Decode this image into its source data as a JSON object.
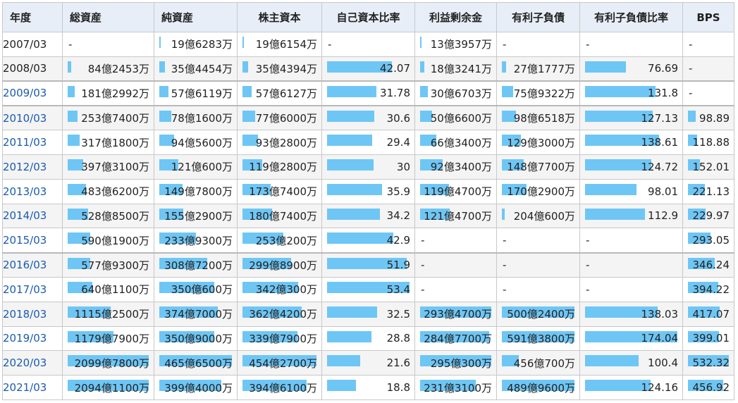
{
  "columns": [
    "年度",
    "総資産",
    "純資産",
    "株主資本",
    "自己資本比率",
    "利益剰余金",
    "有利子負債",
    "有利子負債比率",
    "BPS"
  ],
  "colors": {
    "bar": "#6ec6f5",
    "header_bg": "#e8eef8",
    "link": "#1a5bb0"
  },
  "rows": [
    {
      "year": "2007/03",
      "link": false,
      "cells": [
        {
          "text": "-"
        },
        {
          "text": "19億6283万",
          "ratio": 0.0
        },
        {
          "text": "19億6154万",
          "ratio": 0.0
        },
        {
          "text": "-"
        },
        {
          "text": "13億3957万",
          "ratio": 0.0
        },
        {
          "text": "-"
        },
        {
          "text": "-"
        },
        {
          "text": "-"
        }
      ]
    },
    {
      "year": "2008/03",
      "link": false,
      "cells": [
        {
          "text": "84億2453万",
          "ratio": 0.04
        },
        {
          "text": "35億4454万",
          "ratio": 0.076
        },
        {
          "text": "35億4394万",
          "ratio": 0.078
        },
        {
          "text": "42.07",
          "ratio": 0.79
        },
        {
          "text": "18億3241万",
          "ratio": 0.062
        },
        {
          "text": "27億1777万",
          "ratio": 0.054
        },
        {
          "text": "76.69",
          "ratio": 0.44
        },
        {
          "text": "-"
        }
      ]
    },
    {
      "year": "2009/03",
      "link": true,
      "sep": true,
      "cells": [
        {
          "text": "181億2992万",
          "ratio": 0.087
        },
        {
          "text": "57億6119万",
          "ratio": 0.124
        },
        {
          "text": "57億6127万",
          "ratio": 0.127
        },
        {
          "text": "31.78",
          "ratio": 0.6
        },
        {
          "text": "30億6703万",
          "ratio": 0.104
        },
        {
          "text": "75億9322万",
          "ratio": 0.152
        },
        {
          "text": "131.8",
          "ratio": 0.76
        },
        {
          "text": "-"
        }
      ]
    },
    {
      "year": "2010/03",
      "link": true,
      "sep": true,
      "cells": [
        {
          "text": "253億7400万",
          "ratio": 0.121
        },
        {
          "text": "78億1600万",
          "ratio": 0.168
        },
        {
          "text": "77億6000万",
          "ratio": 0.171
        },
        {
          "text": "30.6",
          "ratio": 0.57
        },
        {
          "text": "50億6600万",
          "ratio": 0.172
        },
        {
          "text": "98億6518万",
          "ratio": 0.197
        },
        {
          "text": "127.13",
          "ratio": 0.73
        },
        {
          "text": "98.89",
          "ratio": 0.186
        }
      ]
    },
    {
      "year": "2011/03",
      "link": true,
      "cells": [
        {
          "text": "317億1800万",
          "ratio": 0.151
        },
        {
          "text": "94億5600万",
          "ratio": 0.203
        },
        {
          "text": "93億2800万",
          "ratio": 0.205
        },
        {
          "text": "29.4",
          "ratio": 0.55
        },
        {
          "text": "66億3400万",
          "ratio": 0.226
        },
        {
          "text": "129億3000万",
          "ratio": 0.258
        },
        {
          "text": "138.61",
          "ratio": 0.8
        },
        {
          "text": "118.88",
          "ratio": 0.223
        }
      ]
    },
    {
      "year": "2012/03",
      "link": true,
      "cells": [
        {
          "text": "397億3100万",
          "ratio": 0.189
        },
        {
          "text": "121億600万",
          "ratio": 0.26
        },
        {
          "text": "119億2800万",
          "ratio": 0.262
        },
        {
          "text": "30",
          "ratio": 0.56
        },
        {
          "text": "92億3400万",
          "ratio": 0.314
        },
        {
          "text": "148億7700万",
          "ratio": 0.297
        },
        {
          "text": "124.72",
          "ratio": 0.72
        },
        {
          "text": "152.01",
          "ratio": 0.286
        }
      ]
    },
    {
      "year": "2013/03",
      "link": true,
      "cells": [
        {
          "text": "483億6200万",
          "ratio": 0.23
        },
        {
          "text": "149億7800万",
          "ratio": 0.322
        },
        {
          "text": "173億7400万",
          "ratio": 0.382
        },
        {
          "text": "35.9",
          "ratio": 0.67
        },
        {
          "text": "119億4700万",
          "ratio": 0.406
        },
        {
          "text": "170億2900万",
          "ratio": 0.34
        },
        {
          "text": "98.01",
          "ratio": 0.56
        },
        {
          "text": "221.13",
          "ratio": 0.415
        }
      ]
    },
    {
      "year": "2014/03",
      "link": true,
      "cells": [
        {
          "text": "528億8500万",
          "ratio": 0.252
        },
        {
          "text": "155億2900万",
          "ratio": 0.334
        },
        {
          "text": "180億7400万",
          "ratio": 0.397
        },
        {
          "text": "34.2",
          "ratio": 0.64
        },
        {
          "text": "121億4700万",
          "ratio": 0.413
        },
        {
          "text": "204億600万",
          "ratio": 0.04
        },
        {
          "text": "112.9",
          "ratio": 0.65
        },
        {
          "text": "229.97",
          "ratio": 0.432
        }
      ]
    },
    {
      "year": "2015/03",
      "link": true,
      "cells": [
        {
          "text": "590億1900万",
          "ratio": 0.281
        },
        {
          "text": "233億9300万",
          "ratio": 0.503
        },
        {
          "text": "253億200万",
          "ratio": 0.556
        },
        {
          "text": "42.9",
          "ratio": 0.8
        },
        {
          "text": "-"
        },
        {
          "text": "-"
        },
        {
          "text": "-"
        },
        {
          "text": "293.05",
          "ratio": 0.55
        }
      ]
    },
    {
      "year": "2016/03",
      "link": true,
      "sep": true,
      "cells": [
        {
          "text": "577億9300万",
          "ratio": 0.275
        },
        {
          "text": "308億7200万",
          "ratio": 0.664
        },
        {
          "text": "299億8900万",
          "ratio": 0.659
        },
        {
          "text": "51.9",
          "ratio": 0.97
        },
        {
          "text": "-"
        },
        {
          "text": "-"
        },
        {
          "text": "-"
        },
        {
          "text": "346.24",
          "ratio": 0.65
        }
      ]
    },
    {
      "year": "2017/03",
      "link": true,
      "cells": [
        {
          "text": "640億1100万",
          "ratio": 0.305
        },
        {
          "text": "350億600万",
          "ratio": 0.753
        },
        {
          "text": "342億300万",
          "ratio": 0.752
        },
        {
          "text": "53.4",
          "ratio": 1.0
        },
        {
          "text": "-"
        },
        {
          "text": "-"
        },
        {
          "text": "-"
        },
        {
          "text": "394.22",
          "ratio": 0.741
        }
      ]
    },
    {
      "year": "2018/03",
      "link": true,
      "cells": [
        {
          "text": "1115億2500万",
          "ratio": 0.531
        },
        {
          "text": "374億7000万",
          "ratio": 0.805
        },
        {
          "text": "362億4200万",
          "ratio": 0.797
        },
        {
          "text": "32.5",
          "ratio": 0.61
        },
        {
          "text": "293億4700万",
          "ratio": 0.998
        },
        {
          "text": "500億2400万",
          "ratio": 1.0
        },
        {
          "text": "138.03",
          "ratio": 0.79
        },
        {
          "text": "417.07",
          "ratio": 0.784
        }
      ]
    },
    {
      "year": "2019/03",
      "link": true,
      "cells": [
        {
          "text": "1179億7900万",
          "ratio": 0.562
        },
        {
          "text": "350億9000万",
          "ratio": 0.755
        },
        {
          "text": "339億7900万",
          "ratio": 0.747
        },
        {
          "text": "28.8",
          "ratio": 0.54
        },
        {
          "text": "284億7700万",
          "ratio": 0.968
        },
        {
          "text": "591億3800万",
          "ratio": 1.0
        },
        {
          "text": "174.04",
          "ratio": 1.0
        },
        {
          "text": "399.01",
          "ratio": 0.75
        }
      ]
    },
    {
      "year": "2020/03",
      "link": true,
      "cells": [
        {
          "text": "2099億7800万",
          "ratio": 1.0
        },
        {
          "text": "465億6500万",
          "ratio": 1.0
        },
        {
          "text": "454億2700万",
          "ratio": 0.999
        },
        {
          "text": "21.6",
          "ratio": 0.4
        },
        {
          "text": "295億300万",
          "ratio": 1.0
        },
        {
          "text": "456億700万",
          "ratio": 0.235
        },
        {
          "text": "100.4",
          "ratio": 0.58
        },
        {
          "text": "532.32",
          "ratio": 1.0
        }
      ]
    },
    {
      "year": "2021/03",
      "link": true,
      "cells": [
        {
          "text": "2094億1100万",
          "ratio": 0.997
        },
        {
          "text": "399億4000万",
          "ratio": 0.858
        },
        {
          "text": "394億6100万",
          "ratio": 0.868
        },
        {
          "text": "18.8",
          "ratio": 0.35
        },
        {
          "text": "231億3100万",
          "ratio": 0.786
        },
        {
          "text": "489億9600万",
          "ratio": 1.0
        },
        {
          "text": "124.16",
          "ratio": 0.71
        },
        {
          "text": "456.92",
          "ratio": 0.858
        }
      ]
    }
  ]
}
